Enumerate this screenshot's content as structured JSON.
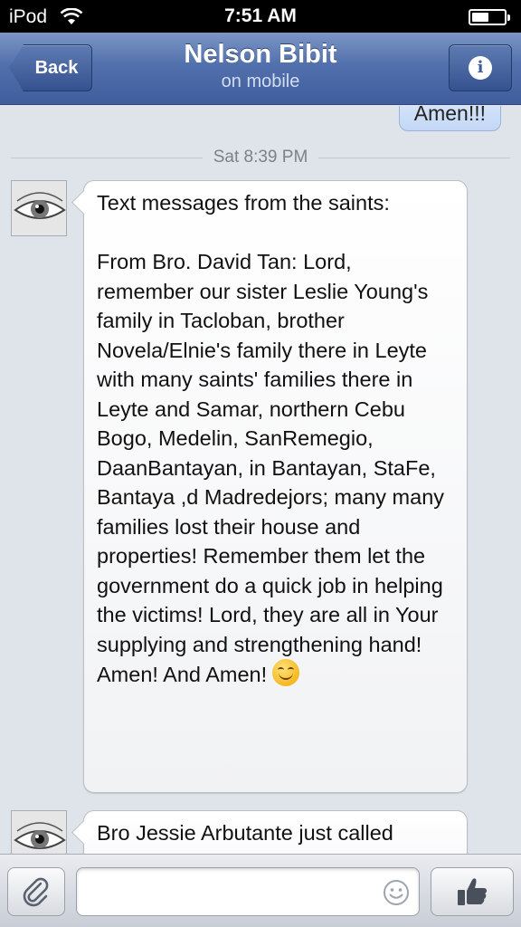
{
  "status_bar": {
    "device": "iPod",
    "time": "7:51 AM",
    "icons": [
      "wifi-icon",
      "battery-icon"
    ]
  },
  "nav": {
    "back_label": "Back",
    "title": "Nelson Bibit",
    "subtitle": "on mobile",
    "info_icon": "info-icon"
  },
  "conversation": {
    "sent_message": "Amen!!!",
    "timestamp": "Sat 8:39 PM",
    "messages": [
      {
        "avatar_icon": "eye-avatar",
        "text": "Text messages from the saints:\n\nFrom Bro. David Tan: Lord, remember our sister Leslie Young's family in Tacloban, brother Novela/Elnie's family there in Leyte with many saints' families there in Leyte and Samar, northern Cebu Bogo, Medelin, SanRemegio, DaanBantayan, in Bantayan, StaFe, Bantaya ,d Madredejors; many many families lost their house and properties! Remember them let the government do a quick job in helping the victims! Lord, they are all in Your supplying and strengthening hand! Amen! And Amen!",
        "emoji": "smiling-face-emoji"
      },
      {
        "avatar_icon": "eye-avatar",
        "text": "Bro Jessie Arbutante just called"
      }
    ]
  },
  "input_bar": {
    "attach_icon": "paperclip-icon",
    "text_value": "",
    "smiley_icon": "smiley-icon",
    "like_icon": "thumbs-up-icon"
  },
  "colors": {
    "nav_bar": "#4f6ea9",
    "background": "#dfe3ea",
    "sent_bubble": "#cddff8"
  }
}
